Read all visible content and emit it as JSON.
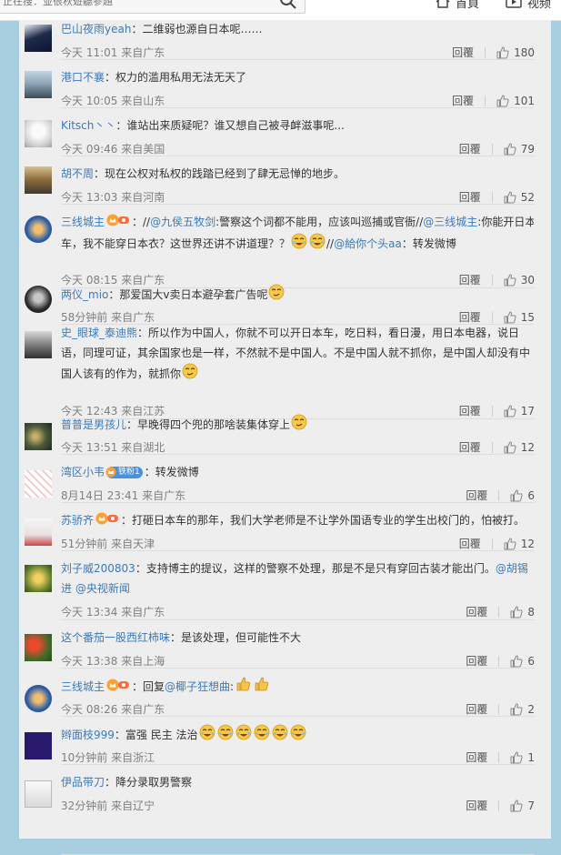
{
  "header": {
    "search_placeholder": "正在搜：並很秋遊聽參題",
    "nav_home": "首頁",
    "nav_video": "视频"
  },
  "colors": {
    "link": "#3a7abf",
    "meta": "#808080",
    "page_bg": "#a8cfe0",
    "panel_bg": "#eeeeee"
  },
  "reply_label": "回覆",
  "comments": [
    {
      "user": "巴山夜雨yeah",
      "segments": [
        {
          "t": "text",
          "v": "：二维弱也源自日本呢……"
        }
      ],
      "time": "今天 11:01 来自广东",
      "likes": "180"
    },
    {
      "user": "港口不襄",
      "segments": [
        {
          "t": "text",
          "v": "：权力的滥用私用无法无天了"
        }
      ],
      "time": "今天 10:05 来自山东",
      "likes": "101"
    },
    {
      "user": "Kitsch丶丶",
      "segments": [
        {
          "t": "text",
          "v": "：谁站出来质疑呢？谁又想自己被寻衅滋事呢..."
        }
      ],
      "time": "今天 09:46 来自美国",
      "likes": "79"
    },
    {
      "user": "胡不周",
      "segments": [
        {
          "t": "text",
          "v": "：现在公权对私权的践踏已经到了肆无忌惮的地步。"
        }
      ],
      "time": "今天 13:03 来自河南",
      "likes": "52"
    },
    {
      "user": "三线城主",
      "segments": [
        {
          "t": "text",
          "v": "：//"
        },
        {
          "t": "mention",
          "v": "@九侯五牧剑"
        },
        {
          "t": "text",
          "v": ":警察这个词都不能用，应该叫巡捕或官衙//"
        },
        {
          "t": "mention",
          "v": "@三线城主"
        },
        {
          "t": "text",
          "v": ":你能开日本"
        },
        {
          "t": "br"
        },
        {
          "t": "text",
          "v": "车，我不能穿日本衣？这世界还讲不讲道理？？"
        },
        {
          "t": "emoji",
          "v": "laugh"
        },
        {
          "t": "emoji",
          "v": "laugh"
        },
        {
          "t": "text",
          "v": "//"
        },
        {
          "t": "mention",
          "v": "@給你个头aa"
        },
        {
          "t": "text",
          "v": "：转发微博"
        }
      ],
      "time": "今天 08:15 来自广东",
      "likes": "30"
    },
    {
      "user": "两仪_mio",
      "segments": [
        {
          "t": "text",
          "v": "：那爱国大v卖日本避孕套广告呢"
        },
        {
          "t": "emoji",
          "v": "smirk"
        }
      ],
      "time": "58分钟前 来自广东",
      "likes": "15"
    },
    {
      "user": "史_眼球_泰迪熊",
      "segments": [
        {
          "t": "text",
          "v": "：所以作为中国人，你就不可以开日本车，吃日料，看日漫，用日本电器，说日"
        },
        {
          "t": "br"
        },
        {
          "t": "text",
          "v": "语，同理可证，其余国家也是一样，不然就不是中国人。不是中国人就不抓你，是中国人却没有中"
        },
        {
          "t": "br"
        },
        {
          "t": "text",
          "v": "国人该有的作为，就抓你"
        },
        {
          "t": "emoji",
          "v": "smirk"
        }
      ],
      "time": "今天 12:43 来自江苏",
      "likes": "17"
    },
    {
      "user": "普普是男孩儿",
      "segments": [
        {
          "t": "text",
          "v": "：早晚得四个兜的那啥装集体穿上"
        },
        {
          "t": "emoji",
          "v": "smirk"
        }
      ],
      "time": "今天 13:51 来自湖北",
      "likes": "12"
    },
    {
      "user": "湾区小韦",
      "segments": [
        {
          "t": "text",
          "v": "：转发微博"
        }
      ],
      "time": "8月14日 23:41 来自广东",
      "likes": "6",
      "badge_text": "铁粉1"
    },
    {
      "user": "苏骄齐",
      "segments": [
        {
          "t": "text",
          "v": "：打砸日本车的那年，我们大学老师是不让学外国语专业的学生出校门的，怕被打。"
        }
      ],
      "time": "51分钟前 来自天津",
      "likes": "12"
    },
    {
      "user": "刘子威200803",
      "segments": [
        {
          "t": "text",
          "v": "：支持博主的提议，这样的警察不处理，那是不是只有穿回古装才能出门。"
        },
        {
          "t": "mention",
          "v": "@胡锡"
        },
        {
          "t": "br"
        },
        {
          "t": "mention",
          "v": "进 @央视新闻"
        }
      ],
      "time": "今天 13:34 来自广东",
      "likes": "8"
    },
    {
      "user": "这个番茄一股西红柿味",
      "segments": [
        {
          "t": "text",
          "v": "：是该处理，但可能性不大"
        }
      ],
      "time": "今天 13:38 来自上海",
      "likes": "6"
    },
    {
      "user": "三线城主",
      "segments": [
        {
          "t": "text",
          "v": "：回复"
        },
        {
          "t": "mention",
          "v": "@椰子狂想曲"
        },
        {
          "t": "text",
          "v": ":"
        },
        {
          "t": "emoji",
          "v": "thumb"
        },
        {
          "t": "emoji",
          "v": "thumb"
        }
      ],
      "time": "今天 08:26 来自广东",
      "likes": "2"
    },
    {
      "user": "辫面枝999",
      "segments": [
        {
          "t": "text",
          "v": "：富强 民主 法治"
        },
        {
          "t": "emoji",
          "v": "laugh"
        },
        {
          "t": "emoji",
          "v": "laugh"
        },
        {
          "t": "emoji",
          "v": "laugh"
        },
        {
          "t": "emoji",
          "v": "laugh"
        },
        {
          "t": "emoji",
          "v": "laugh"
        },
        {
          "t": "emoji",
          "v": "laugh"
        }
      ],
      "time": "10分钟前 来自浙江",
      "likes": "1"
    },
    {
      "user": "伊品带刀",
      "segments": [
        {
          "t": "text",
          "v": "：降分录取男警察"
        }
      ],
      "time": "32分钟前 来自辽宁",
      "likes": "7"
    }
  ]
}
